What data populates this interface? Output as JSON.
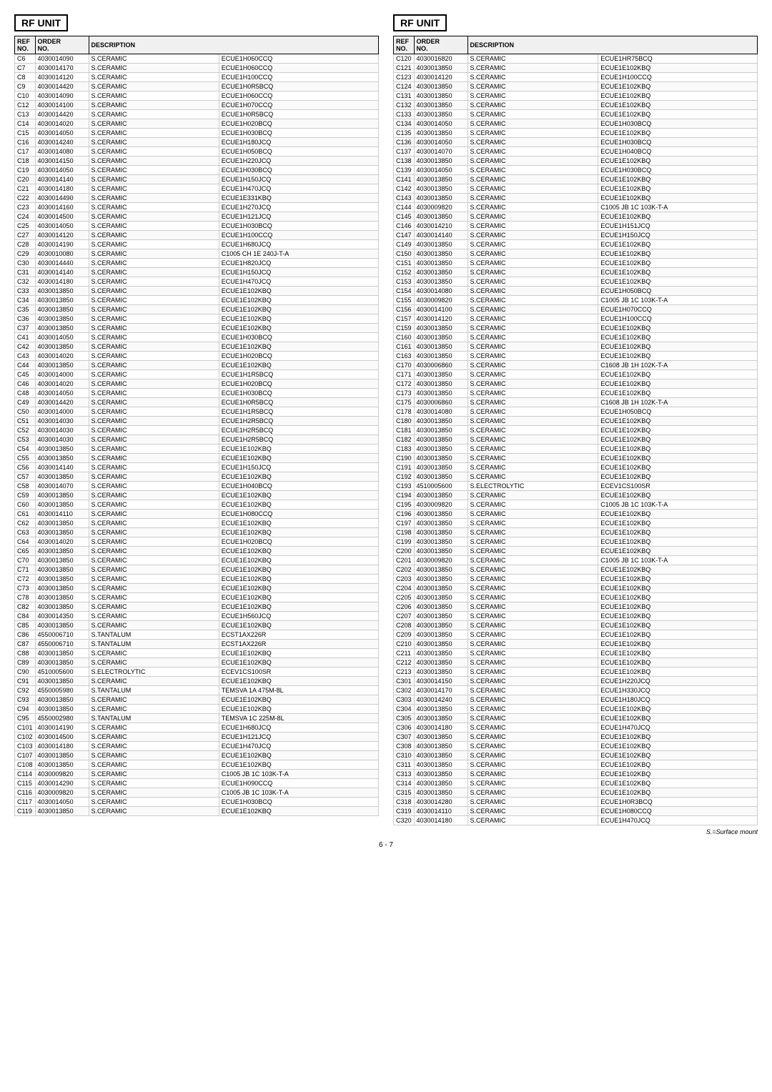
{
  "page": {
    "title_left": "RF UNIT",
    "title_right": "RF UNIT",
    "page_number": "6 - 7",
    "footnote": "S.=Surface mount"
  },
  "left_table": {
    "headers": [
      "REF\nNO.",
      "ORDER\nNO.",
      "DESCRIPTION"
    ],
    "rows": [
      [
        "C6",
        "4030014090",
        "S.CERAMIC",
        "ECUE1H060CCQ"
      ],
      [
        "C7",
        "4030014170",
        "S.CERAMIC",
        "ECUE1H060CCQ"
      ],
      [
        "C8",
        "4030014120",
        "S.CERAMIC",
        "ECUE1H100CCQ"
      ],
      [
        "C9",
        "4030014420",
        "S.CERAMIC",
        "ECUE1H0R5BCQ"
      ],
      [
        "C10",
        "4030014090",
        "S.CERAMIC",
        "ECUE1H060CCQ"
      ],
      [
        "C12",
        "4030014100",
        "S.CERAMIC",
        "ECUE1H070CCQ"
      ],
      [
        "C13",
        "4030014420",
        "S.CERAMIC",
        "ECUE1H0R5BCQ"
      ],
      [
        "C14",
        "4030014020",
        "S.CERAMIC",
        "ECUE1H020BCQ"
      ],
      [
        "C15",
        "4030014050",
        "S.CERAMIC",
        "ECUE1H030BCQ"
      ],
      [
        "C16",
        "4030014240",
        "S.CERAMIC",
        "ECUE1H180JCQ"
      ],
      [
        "C17",
        "4030014080",
        "S.CERAMIC",
        "ECUE1H050BCQ"
      ],
      [
        "C18",
        "4030014150",
        "S.CERAMIC",
        "ECUE1H220JCQ"
      ],
      [
        "C19",
        "4030014050",
        "S.CERAMIC",
        "ECUE1H030BCQ"
      ],
      [
        "C20",
        "4030014140",
        "S.CERAMIC",
        "ECUE1H150JCQ"
      ],
      [
        "C21",
        "4030014180",
        "S.CERAMIC",
        "ECUE1H470JCQ"
      ],
      [
        "C22",
        "4030014490",
        "S.CERAMIC",
        "ECUE1E331KBQ"
      ],
      [
        "C23",
        "4030014160",
        "S.CERAMIC",
        "ECUE1H270JCQ"
      ],
      [
        "C24",
        "4030014500",
        "S.CERAMIC",
        "ECUE1H121JCQ"
      ],
      [
        "C25",
        "4030014050",
        "S.CERAMIC",
        "ECUE1H030BCQ"
      ],
      [
        "C27",
        "4030014120",
        "S.CERAMIC",
        "ECUE1H100CCQ"
      ],
      [
        "C28",
        "4030014190",
        "S.CERAMIC",
        "ECUE1H680JCQ"
      ],
      [
        "C29",
        "4030010080",
        "S.CERAMIC",
        "C1005 CH 1E 240J-T-A"
      ],
      [
        "C30",
        "4030014440",
        "S.CERAMIC",
        "ECUE1H820JCQ"
      ],
      [
        "C31",
        "4030014140",
        "S.CERAMIC",
        "ECUE1H150JCQ"
      ],
      [
        "C32",
        "4030014180",
        "S.CERAMIC",
        "ECUE1H470JCQ"
      ],
      [
        "C33",
        "4030013850",
        "S.CERAMIC",
        "ECUE1E102KBQ"
      ],
      [
        "C34",
        "4030013850",
        "S.CERAMIC",
        "ECUE1E102KBQ"
      ],
      [
        "C35",
        "4030013850",
        "S.CERAMIC",
        "ECUE1E102KBQ"
      ],
      [
        "C36",
        "4030013850",
        "S.CERAMIC",
        "ECUE1E102KBQ"
      ],
      [
        "C37",
        "4030013850",
        "S.CERAMIC",
        "ECUE1E102KBQ"
      ],
      [
        "C41",
        "4030014050",
        "S.CERAMIC",
        "ECUE1H030BCQ"
      ],
      [
        "C42",
        "4030013850",
        "S.CERAMIC",
        "ECUE1E102KBQ"
      ],
      [
        "C43",
        "4030014020",
        "S.CERAMIC",
        "ECUE1H020BCQ"
      ],
      [
        "C44",
        "4030013850",
        "S.CERAMIC",
        "ECUE1E102KBQ"
      ],
      [
        "C45",
        "4030014000",
        "S.CERAMIC",
        "ECUE1H1R5BCQ"
      ],
      [
        "C46",
        "4030014020",
        "S.CERAMIC",
        "ECUE1H020BCQ"
      ],
      [
        "C48",
        "4030014050",
        "S.CERAMIC",
        "ECUE1H030BCQ"
      ],
      [
        "C49",
        "4030014420",
        "S.CERAMIC",
        "ECUE1H0R5BCQ"
      ],
      [
        "C50",
        "4030014000",
        "S.CERAMIC",
        "ECUE1H1R5BCQ"
      ],
      [
        "C51",
        "4030014030",
        "S.CERAMIC",
        "ECUE1H2R5BCQ"
      ],
      [
        "C52",
        "4030014030",
        "S.CERAMIC",
        "ECUE1H2R5BCQ"
      ],
      [
        "C53",
        "4030014030",
        "S.CERAMIC",
        "ECUE1H2R5BCQ"
      ],
      [
        "C54",
        "4030013850",
        "S.CERAMIC",
        "ECUE1E102KBQ"
      ],
      [
        "C55",
        "4030013850",
        "S.CERAMIC",
        "ECUE1E102KBQ"
      ],
      [
        "C56",
        "4030014140",
        "S.CERAMIC",
        "ECUE1H150JCQ"
      ],
      [
        "C57",
        "4030013850",
        "S.CERAMIC",
        "ECUE1E102KBQ"
      ],
      [
        "C58",
        "4030014070",
        "S.CERAMIC",
        "ECUE1H040BCQ"
      ],
      [
        "C59",
        "4030013850",
        "S.CERAMIC",
        "ECUE1E102KBQ"
      ],
      [
        "C60",
        "4030013850",
        "S.CERAMIC",
        "ECUE1E102KBQ"
      ],
      [
        "C61",
        "4030014110",
        "S.CERAMIC",
        "ECUE1H080CCQ"
      ],
      [
        "C62",
        "4030013850",
        "S.CERAMIC",
        "ECUE1E102KBQ"
      ],
      [
        "C63",
        "4030013850",
        "S.CERAMIC",
        "ECUE1E102KBQ"
      ],
      [
        "C64",
        "4030014020",
        "S.CERAMIC",
        "ECUE1H020BCQ"
      ],
      [
        "C65",
        "4030013850",
        "S.CERAMIC",
        "ECUE1E102KBQ"
      ],
      [
        "C70",
        "4030013850",
        "S.CERAMIC",
        "ECUE1E102KBQ"
      ],
      [
        "C71",
        "4030013850",
        "S.CERAMIC",
        "ECUE1E102KBQ"
      ],
      [
        "C72",
        "4030013850",
        "S.CERAMIC",
        "ECUE1E102KBQ"
      ],
      [
        "C73",
        "4030013850",
        "S.CERAMIC",
        "ECUE1E102KBQ"
      ],
      [
        "C78",
        "4030013850",
        "S.CERAMIC",
        "ECUE1E102KBQ"
      ],
      [
        "C82",
        "4030013850",
        "S.CERAMIC",
        "ECUE1E102KBQ"
      ],
      [
        "C84",
        "4030014350",
        "S.CERAMIC",
        "ECUE1H560JCQ"
      ],
      [
        "C85",
        "4030013850",
        "S.CERAMIC",
        "ECUE1E102KBQ"
      ],
      [
        "C86",
        "4550006710",
        "S.TANTALUM",
        "ECST1AX226R"
      ],
      [
        "C87",
        "4550006710",
        "S.TANTALUM",
        "ECST1AX226R"
      ],
      [
        "C88",
        "4030013850",
        "S.CERAMIC",
        "ECUE1E102KBQ"
      ],
      [
        "C89",
        "4030013850",
        "S.CERAMIC",
        "ECUE1E102KBQ"
      ],
      [
        "C90",
        "4510005600",
        "S.ELECTROLYTIC",
        "ECEV1CS100SR"
      ],
      [
        "C91",
        "4030013850",
        "S.CERAMIC",
        "ECUE1E102KBQ"
      ],
      [
        "C92",
        "4550005980",
        "S.TANTALUM",
        "TEMSVA 1A 475M-8L"
      ],
      [
        "C93",
        "4030013850",
        "S.CERAMIC",
        "ECUE1E102KBQ"
      ],
      [
        "C94",
        "4030013850",
        "S.CERAMIC",
        "ECUE1E102KBQ"
      ],
      [
        "C95",
        "4550002980",
        "S.TANTALUM",
        "TEMSVA 1C 225M-8L"
      ],
      [
        "C101",
        "4030014190",
        "S.CERAMIC",
        "ECUE1H680JCQ"
      ],
      [
        "C102",
        "4030014500",
        "S.CERAMIC",
        "ECUE1H121JCQ"
      ],
      [
        "C103",
        "4030014180",
        "S.CERAMIC",
        "ECUE1H470JCQ"
      ],
      [
        "C107",
        "4030013850",
        "S.CERAMIC",
        "ECUE1E102KBQ"
      ],
      [
        "C108",
        "4030013850",
        "S.CERAMIC",
        "ECUE1E102KBQ"
      ],
      [
        "C114",
        "4030009820",
        "S.CERAMIC",
        "C1005 JB 1C 103K-T-A"
      ],
      [
        "C115",
        "4030014290",
        "S.CERAMIC",
        "ECUE1H090CCQ"
      ],
      [
        "C116",
        "4030009820",
        "S.CERAMIC",
        "C1005 JB 1C 103K-T-A"
      ],
      [
        "C117",
        "4030014050",
        "S.CERAMIC",
        "ECUE1H030BCQ"
      ],
      [
        "C119",
        "4030013850",
        "S.CERAMIC",
        "ECUE1E102KBQ"
      ]
    ]
  },
  "right_table": {
    "headers": [
      "REF\nNO.",
      "ORDER\nNO.",
      "DESCRIPTION"
    ],
    "rows": [
      [
        "C120",
        "4030016820",
        "S.CERAMIC",
        "ECUE1HR75BCQ"
      ],
      [
        "C121",
        "4030013850",
        "S.CERAMIC",
        "ECUE1E102KBQ"
      ],
      [
        "C123",
        "4030014120",
        "S.CERAMIC",
        "ECUE1H100CCQ"
      ],
      [
        "C124",
        "4030013850",
        "S.CERAMIC",
        "ECUE1E102KBQ"
      ],
      [
        "C131",
        "4030013850",
        "S.CERAMIC",
        "ECUE1E102KBQ"
      ],
      [
        "C132",
        "4030013850",
        "S.CERAMIC",
        "ECUE1E102KBQ"
      ],
      [
        "C133",
        "4030013850",
        "S.CERAMIC",
        "ECUE1E102KBQ"
      ],
      [
        "C134",
        "4030014050",
        "S.CERAMIC",
        "ECUE1H030BCQ"
      ],
      [
        "C135",
        "4030013850",
        "S.CERAMIC",
        "ECUE1E102KBQ"
      ],
      [
        "C136",
        "4030014050",
        "S.CERAMIC",
        "ECUE1H030BCQ"
      ],
      [
        "C137",
        "4030014070",
        "S.CERAMIC",
        "ECUE1H040BCQ"
      ],
      [
        "C138",
        "4030013850",
        "S.CERAMIC",
        "ECUE1E102KBQ"
      ],
      [
        "C139",
        "4030014050",
        "S.CERAMIC",
        "ECUE1H030BCQ"
      ],
      [
        "C141",
        "4030013850",
        "S.CERAMIC",
        "ECUE1E102KBQ"
      ],
      [
        "C142",
        "4030013850",
        "S.CERAMIC",
        "ECUE1E102KBQ"
      ],
      [
        "C143",
        "4030013850",
        "S.CERAMIC",
        "ECUE1E102KBQ"
      ],
      [
        "C144",
        "4030009820",
        "S.CERAMIC",
        "C1005 JB 1C 103K-T-A"
      ],
      [
        "C145",
        "4030013850",
        "S.CERAMIC",
        "ECUE1E102KBQ"
      ],
      [
        "C146",
        "4030014210",
        "S.CERAMIC",
        "ECUE1H151JCQ"
      ],
      [
        "C147",
        "4030014140",
        "S.CERAMIC",
        "ECUE1H150JCQ"
      ],
      [
        "C149",
        "4030013850",
        "S.CERAMIC",
        "ECUE1E102KBQ"
      ],
      [
        "C150",
        "4030013850",
        "S.CERAMIC",
        "ECUE1E102KBQ"
      ],
      [
        "C151",
        "4030013850",
        "S.CERAMIC",
        "ECUE1E102KBQ"
      ],
      [
        "C152",
        "4030013850",
        "S.CERAMIC",
        "ECUE1E102KBQ"
      ],
      [
        "C153",
        "4030013850",
        "S.CERAMIC",
        "ECUE1E102KBQ"
      ],
      [
        "C154",
        "4030014080",
        "S.CERAMIC",
        "ECUE1H050BCQ"
      ],
      [
        "C155",
        "4030009820",
        "S.CERAMIC",
        "C1005 JB 1C 103K-T-A"
      ],
      [
        "C156",
        "4030014100",
        "S.CERAMIC",
        "ECUE1H070CCQ"
      ],
      [
        "C157",
        "4030014120",
        "S.CERAMIC",
        "ECUE1H100CCQ"
      ],
      [
        "C159",
        "4030013850",
        "S.CERAMIC",
        "ECUE1E102KBQ"
      ],
      [
        "C160",
        "4030013850",
        "S.CERAMIC",
        "ECUE1E102KBQ"
      ],
      [
        "C161",
        "4030013850",
        "S.CERAMIC",
        "ECUE1E102KBQ"
      ],
      [
        "C163",
        "4030013850",
        "S.CERAMIC",
        "ECUE1E102KBQ"
      ],
      [
        "C170",
        "4030006860",
        "S.CERAMIC",
        "C1608 JB 1H 102K-T-A"
      ],
      [
        "C171",
        "4030013850",
        "S.CERAMIC",
        "ECUE1E102KBQ"
      ],
      [
        "C172",
        "4030013850",
        "S.CERAMIC",
        "ECUE1E102KBQ"
      ],
      [
        "C173",
        "4030013850",
        "S.CERAMIC",
        "ECUE1E102KBQ"
      ],
      [
        "C175",
        "4030006860",
        "S.CERAMIC",
        "C1608 JB 1H 102K-T-A"
      ],
      [
        "C178",
        "4030014080",
        "S.CERAMIC",
        "ECUE1H050BCQ"
      ],
      [
        "C180",
        "4030013850",
        "S.CERAMIC",
        "ECUE1E102KBQ"
      ],
      [
        "C181",
        "4030013850",
        "S.CERAMIC",
        "ECUE1E102KBQ"
      ],
      [
        "C182",
        "4030013850",
        "S.CERAMIC",
        "ECUE1E102KBQ"
      ],
      [
        "C183",
        "4030013850",
        "S.CERAMIC",
        "ECUE1E102KBQ"
      ],
      [
        "C190",
        "4030013850",
        "S.CERAMIC",
        "ECUE1E102KBQ"
      ],
      [
        "C191",
        "4030013850",
        "S.CERAMIC",
        "ECUE1E102KBQ"
      ],
      [
        "C192",
        "4030013850",
        "S.CERAMIC",
        "ECUE1E102KBQ"
      ],
      [
        "C193",
        "4510005600",
        "S.ELECTROLYTIC",
        "ECEV1CS100SR"
      ],
      [
        "C194",
        "4030013850",
        "S.CERAMIC",
        "ECUE1E102KBQ"
      ],
      [
        "C195",
        "4030009820",
        "S.CERAMIC",
        "C1005 JB 1C 103K-T-A"
      ],
      [
        "C196",
        "4030013850",
        "S.CERAMIC",
        "ECUE1E102KBQ"
      ],
      [
        "C197",
        "4030013850",
        "S.CERAMIC",
        "ECUE1E102KBQ"
      ],
      [
        "C198",
        "4030013850",
        "S.CERAMIC",
        "ECUE1E102KBQ"
      ],
      [
        "C199",
        "4030013850",
        "S.CERAMIC",
        "ECUE1E102KBQ"
      ],
      [
        "C200",
        "4030013850",
        "S.CERAMIC",
        "ECUE1E102KBQ"
      ],
      [
        "C201",
        "4030009820",
        "S.CERAMIC",
        "C1005 JB 1C 103K-T-A"
      ],
      [
        "C202",
        "4030013850",
        "S.CERAMIC",
        "ECUE1E102KBQ"
      ],
      [
        "C203",
        "4030013850",
        "S.CERAMIC",
        "ECUE1E102KBQ"
      ],
      [
        "C204",
        "4030013850",
        "S.CERAMIC",
        "ECUE1E102KBQ"
      ],
      [
        "C205",
        "4030013850",
        "S.CERAMIC",
        "ECUE1E102KBQ"
      ],
      [
        "C206",
        "4030013850",
        "S.CERAMIC",
        "ECUE1E102KBQ"
      ],
      [
        "C207",
        "4030013850",
        "S.CERAMIC",
        "ECUE1E102KBQ"
      ],
      [
        "C208",
        "4030013850",
        "S.CERAMIC",
        "ECUE1E102KBQ"
      ],
      [
        "C209",
        "4030013850",
        "S.CERAMIC",
        "ECUE1E102KBQ"
      ],
      [
        "C210",
        "4030013850",
        "S.CERAMIC",
        "ECUE1E102KBQ"
      ],
      [
        "C211",
        "4030013850",
        "S.CERAMIC",
        "ECUE1E102KBQ"
      ],
      [
        "C212",
        "4030013850",
        "S.CERAMIC",
        "ECUE1E102KBQ"
      ],
      [
        "C213",
        "4030013850",
        "S.CERAMIC",
        "ECUE1E102KBQ"
      ],
      [
        "C301",
        "4030014150",
        "S.CERAMIC",
        "ECUE1H220JCQ"
      ],
      [
        "C302",
        "4030014170",
        "S.CERAMIC",
        "ECUE1H330JCQ"
      ],
      [
        "C303",
        "4030014240",
        "S.CERAMIC",
        "ECUE1H180JCQ"
      ],
      [
        "C304",
        "4030013850",
        "S.CERAMIC",
        "ECUE1E102KBQ"
      ],
      [
        "C305",
        "4030013850",
        "S.CERAMIC",
        "ECUE1E102KBQ"
      ],
      [
        "C306",
        "4030014180",
        "S.CERAMIC",
        "ECUE1H470JCQ"
      ],
      [
        "C307",
        "4030013850",
        "S.CERAMIC",
        "ECUE1E102KBQ"
      ],
      [
        "C308",
        "4030013850",
        "S.CERAMIC",
        "ECUE1E102KBQ"
      ],
      [
        "C310",
        "4030013850",
        "S.CERAMIC",
        "ECUE1E102KBQ"
      ],
      [
        "C311",
        "4030013850",
        "S.CERAMIC",
        "ECUE1E102KBQ"
      ],
      [
        "C313",
        "4030013850",
        "S.CERAMIC",
        "ECUE1E102KBQ"
      ],
      [
        "C314",
        "4030013850",
        "S.CERAMIC",
        "ECUE1E102KBQ"
      ],
      [
        "C315",
        "4030013850",
        "S.CERAMIC",
        "ECUE1E102KBQ"
      ],
      [
        "C318",
        "4030014280",
        "S.CERAMIC",
        "ECUE1H0R3BCQ"
      ],
      [
        "C319",
        "4030014110",
        "S.CERAMIC",
        "ECUE1H080CCQ"
      ],
      [
        "C320",
        "4030014180",
        "S.CERAMIC",
        "ECUE1H470JCQ"
      ]
    ]
  }
}
